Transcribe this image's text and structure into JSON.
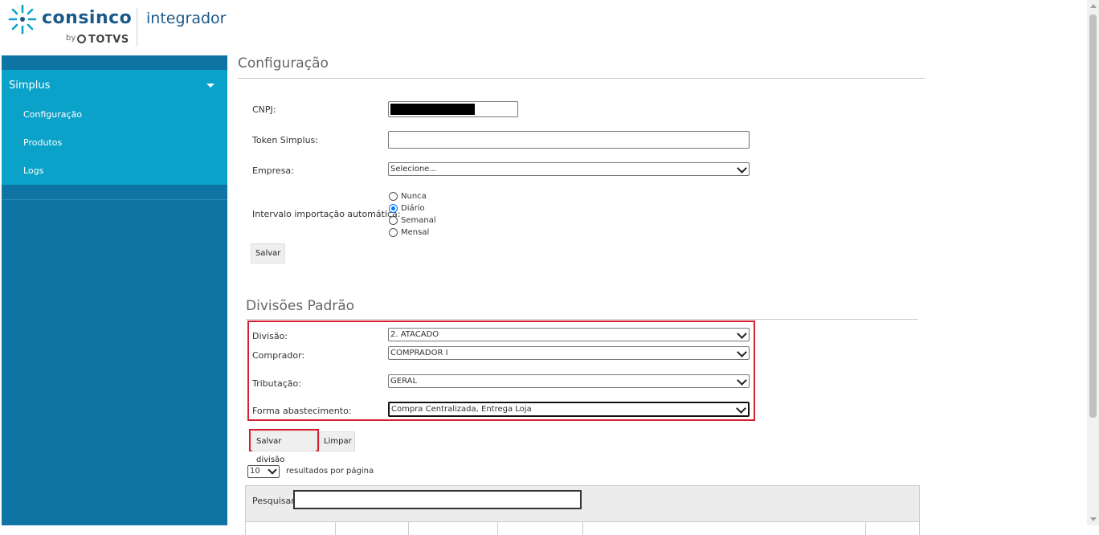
{
  "header": {
    "brand": "consinco",
    "by": "by",
    "partner": "TOTVS",
    "product": "integrador"
  },
  "sidebar": {
    "group_label": "Simplus",
    "items": [
      {
        "label": "Configuração"
      },
      {
        "label": "Produtos"
      },
      {
        "label": "Logs"
      }
    ]
  },
  "config": {
    "title": "Configuração",
    "cnpj_label": "CNPJ:",
    "token_label": "Token Simplus:",
    "token_value": "",
    "empresa_label": "Empresa:",
    "empresa_value": "Selecione...",
    "intervalo_label": "Intervalo importação automática:",
    "intervalo_options": [
      {
        "label": "Nunca",
        "checked": false
      },
      {
        "label": "Diário",
        "checked": true
      },
      {
        "label": "Semanal",
        "checked": false
      },
      {
        "label": "Mensal",
        "checked": false
      }
    ],
    "save_label": "Salvar"
  },
  "divisoes": {
    "title": "Divisões Padrão",
    "divisao_label": "Divisão:",
    "divisao_value": "2. ATACADO",
    "comprador_label": "Comprador:",
    "comprador_value": "COMPRADOR I",
    "tributacao_label": "Tributação:",
    "tributacao_value": "GERAL",
    "forma_label": "Forma abastecimento:",
    "forma_value": "Compra Centralizada, Entrega Loja",
    "save_label": "Salvar divisão",
    "clear_label": "Limpar"
  },
  "table": {
    "page_size": "10",
    "page_size_label": "resultados por página",
    "search_label": "Pesquisar",
    "search_value": ""
  },
  "colors": {
    "sidebar_dark": "#0e74a3",
    "sidebar_light": "#0aa2c9",
    "highlight_red": "#d32031"
  }
}
